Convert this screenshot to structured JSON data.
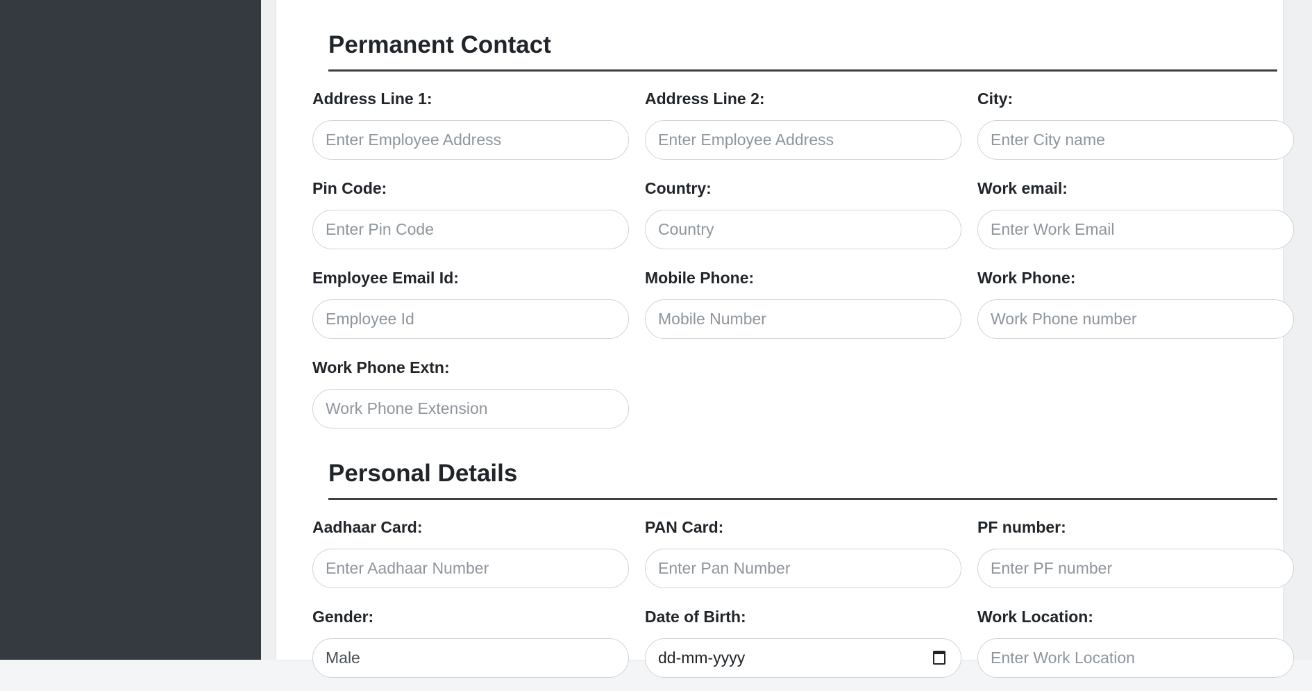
{
  "sections": {
    "permanent_contact": {
      "title": "Permanent Contact",
      "fields": {
        "address1": {
          "label": "Address Line 1:",
          "placeholder": "Enter Employee Address"
        },
        "address2": {
          "label": "Address Line 2:",
          "placeholder": "Enter Employee Address"
        },
        "city": {
          "label": "City:",
          "placeholder": "Enter City name"
        },
        "pin": {
          "label": "Pin Code:",
          "placeholder": "Enter Pin Code"
        },
        "country": {
          "label": "Country:",
          "placeholder": "Country"
        },
        "work_email": {
          "label": "Work email:",
          "placeholder": "Enter Work Email"
        },
        "employee_email": {
          "label": "Employee Email Id:",
          "placeholder": "Employee Id"
        },
        "mobile": {
          "label": "Mobile Phone:",
          "placeholder": "Mobile Number"
        },
        "work_phone": {
          "label": "Work Phone:",
          "placeholder": "Work Phone number"
        },
        "work_phone_extn": {
          "label": "Work Phone Extn:",
          "placeholder": "Work Phone Extension"
        }
      }
    },
    "personal_details": {
      "title": "Personal Details",
      "fields": {
        "aadhaar": {
          "label": "Aadhaar Card:",
          "placeholder": "Enter Aadhaar Number"
        },
        "pan": {
          "label": "PAN Card:",
          "placeholder": "Enter Pan Number"
        },
        "pf": {
          "label": "PF number:",
          "placeholder": "Enter PF number"
        },
        "gender": {
          "label": "Gender:",
          "value": "Male"
        },
        "dob": {
          "label": "Date of Birth:",
          "value": "dd-mm-yyyy"
        },
        "work_location": {
          "label": "Work Location:",
          "placeholder": "Enter Work Location"
        }
      }
    }
  },
  "icons": {
    "date_picker": "calendar-icon"
  }
}
